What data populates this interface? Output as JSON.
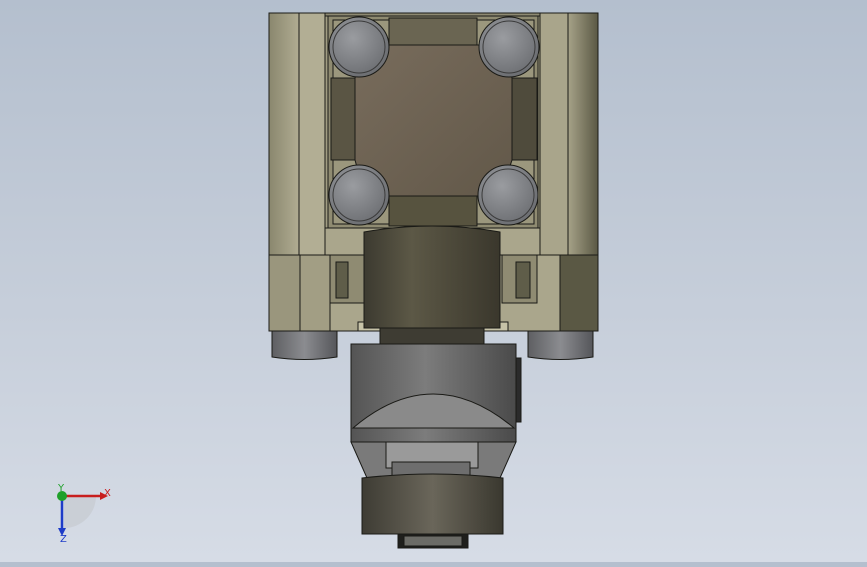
{
  "viewport": {
    "model": "valve-assembly-bottom-view",
    "background_top": "#b4bfce",
    "background_bottom": "#d6dce6"
  },
  "materials": {
    "body_light": "#a9a58a",
    "body_mid": "#8e8b72",
    "body_dark": "#55533f",
    "housing": "#6d6353",
    "bolt": "#7a7c80",
    "metal_light": "#8a8a8a",
    "metal_dark": "#4a4a48"
  },
  "triad": {
    "x_label": "X",
    "y_label": "Y",
    "z_label": "Z",
    "x_color": "#c81e1e",
    "y_color": "#1fa02a",
    "z_color": "#1e3cc8"
  }
}
